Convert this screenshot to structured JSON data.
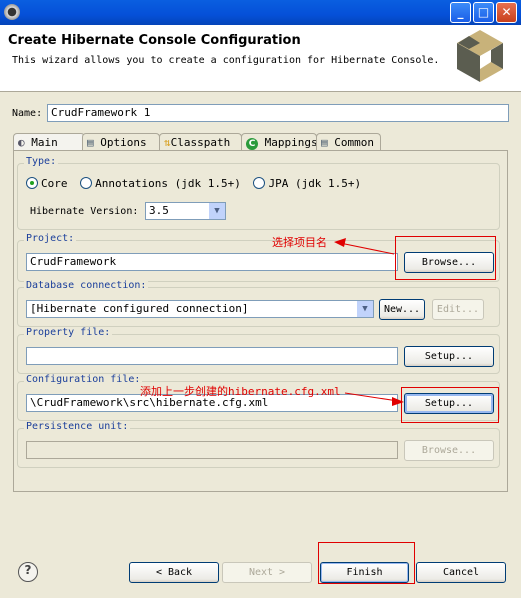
{
  "window": {
    "title": "",
    "icon": "gear-icon",
    "controls": [
      "minimize",
      "maximize",
      "close"
    ]
  },
  "header": {
    "title": "Create Hibernate Console Configuration",
    "description": "This wizard allows you to create a configuration for Hibernate Console.",
    "logo": "hibernate-cube-logo"
  },
  "name": {
    "label": "Name:",
    "value": "CrudFramework 1"
  },
  "tabs": [
    {
      "label": "Main",
      "icon": "main-icon",
      "selected": true
    },
    {
      "label": "Options",
      "icon": "table-icon"
    },
    {
      "label": "Classpath",
      "icon": "classpath-icon"
    },
    {
      "label": "Mappings",
      "icon": "mappings-c-icon"
    },
    {
      "label": "Common",
      "icon": "table-icon"
    }
  ],
  "type": {
    "label": "Type:",
    "options": [
      "Core",
      "Annotations (jdk 1.5+)",
      "JPA (jdk 1.5+)"
    ],
    "selected": "Core",
    "version_label": "Hibernate Version:",
    "version_value": "3.5"
  },
  "project": {
    "label": "Project:",
    "value": "CrudFramework",
    "browse": "Browse..."
  },
  "db": {
    "label": "Database connection:",
    "value": "[Hibernate configured connection]",
    "new": "New...",
    "edit": "Edit..."
  },
  "property": {
    "label": "Property file:",
    "value": "",
    "setup": "Setup..."
  },
  "config": {
    "label": "Configuration file:",
    "value": "\\CrudFramework\\src\\hibernate.cfg.xml",
    "setup": "Setup..."
  },
  "persistence": {
    "label": "Persistence unit:",
    "value": "",
    "browse": "Browse..."
  },
  "annotations": {
    "project_note": "选择项目名",
    "config_note": "添加上一步创建的hibernate.cfg.xml",
    "color": "#e00000"
  },
  "footer": {
    "help": "?",
    "back": "< Back",
    "next": "Next >",
    "finish": "Finish",
    "cancel": "Cancel"
  }
}
